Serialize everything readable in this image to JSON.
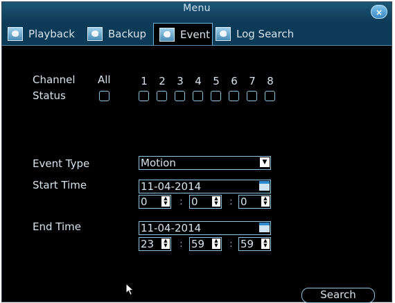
{
  "window": {
    "title": "Menu",
    "close_glyph": "×"
  },
  "tabs": [
    {
      "label": "Playback",
      "icon": "camera-icon",
      "active": false
    },
    {
      "label": "Backup",
      "icon": "camera-icon",
      "active": false
    },
    {
      "label": "Event",
      "icon": "camera-icon",
      "active": true
    },
    {
      "label": "Log Search",
      "icon": "camera-icon",
      "active": false
    }
  ],
  "channel": {
    "label": "Channel",
    "status_label": "Status",
    "all_label": "All",
    "numbers": [
      "1",
      "2",
      "3",
      "4",
      "5",
      "6",
      "7",
      "8"
    ],
    "checked": [
      false,
      false,
      false,
      false,
      false,
      false,
      false,
      false,
      false
    ]
  },
  "event_type": {
    "label": "Event Type",
    "value": "Motion"
  },
  "start_time": {
    "label": "Start Time",
    "date": "11-04-2014",
    "hour": "0",
    "minute": "0",
    "second": "0"
  },
  "end_time": {
    "label": "End Time",
    "date": "11-04-2014",
    "hour": "23",
    "minute": "59",
    "second": "59"
  },
  "time_separator": ":",
  "search_button": {
    "label": "Search"
  },
  "colors": {
    "accent": "#8fc4e3",
    "titlebar": "#1e5677",
    "background": "#000000"
  }
}
